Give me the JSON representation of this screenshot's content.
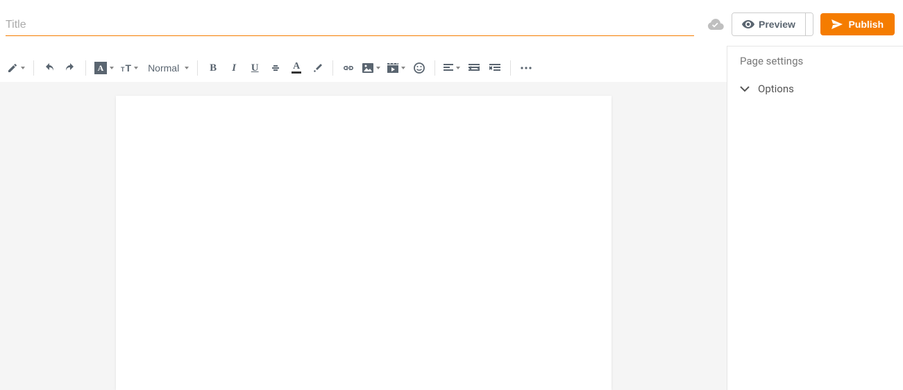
{
  "header": {
    "title_value": "",
    "title_placeholder": "Title",
    "preview_label": "Preview",
    "publish_label": "Publish",
    "cloud_status": "saved"
  },
  "toolbar": {
    "compose_icon": "pencil",
    "undo_icon": "undo",
    "redo_icon": "redo",
    "font_box_label": "A",
    "font_size_label": "T",
    "paragraph_format": "Normal",
    "bold": "B",
    "italic": "I",
    "underline": "U",
    "strike": "S",
    "text_color": "A",
    "highlight_icon": "highlighter",
    "link_icon": "link",
    "image_icon": "image",
    "video_icon": "video",
    "emoji_icon": "smiley",
    "align_icon": "align",
    "outdent_icon": "outdent",
    "indent_icon": "indent",
    "more_icon": "more"
  },
  "sidebar": {
    "settings_title": "Page settings",
    "options_label": "Options"
  },
  "colors": {
    "accent": "#f57c00",
    "icon": "#5a6570",
    "muted": "#aaa"
  }
}
